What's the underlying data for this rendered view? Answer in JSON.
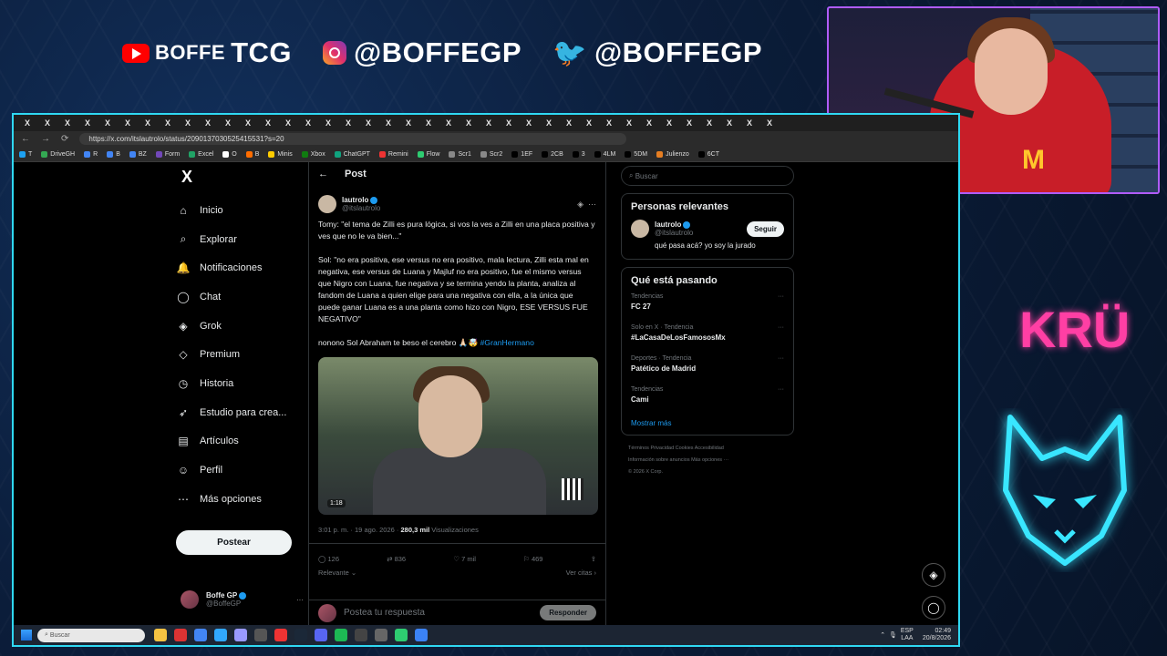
{
  "banner": {
    "yt_text": "BOFFE",
    "yt_bold": "TCG",
    "ig_handle": "@BOFFEGP",
    "tw_handle": "@BOFFEGP"
  },
  "overlay": {
    "kru_logo": "KRÜ"
  },
  "browser": {
    "tab_glyph": "X",
    "url": "https://x.com/itslautrolo/status/2090137030525415531?s=20",
    "bookmarks": [
      "T",
      "DriveGH",
      "R",
      "B",
      "BZ",
      "Form",
      "Excel",
      "O",
      "B",
      "Minis",
      "Xbox",
      "ChatGPT",
      "Remini",
      "Flow",
      "Scr1",
      "Scr2",
      "1EF",
      "2CB",
      "3",
      "4LM",
      "5DM",
      "Julienzo",
      "6CT"
    ]
  },
  "nav": {
    "logo": "X",
    "items": [
      {
        "icon": "⌂",
        "label": "Inicio"
      },
      {
        "icon": "⌕",
        "label": "Explorar"
      },
      {
        "icon": "🔔",
        "label": "Notificaciones"
      },
      {
        "icon": "◯",
        "label": "Chat"
      },
      {
        "icon": "◈",
        "label": "Grok"
      },
      {
        "icon": "◇",
        "label": "Premium"
      },
      {
        "icon": "◷",
        "label": "Historia"
      },
      {
        "icon": "➶",
        "label": "Estudio para crea..."
      },
      {
        "icon": "▤",
        "label": "Artículos"
      },
      {
        "icon": "☺",
        "label": "Perfil"
      },
      {
        "icon": "⋯",
        "label": "Más opciones"
      }
    ],
    "post_button": "Postear",
    "profile": {
      "name": "Boffe GP",
      "handle": "@BoffeGP"
    }
  },
  "post": {
    "header": "Post",
    "author": {
      "name": "lautrolo",
      "handle": "@itslautrolo"
    },
    "text_1": "Tomy: \"el tema de Zilli es pura lógica, si vos la ves a Zilli en una placa positiva y ves que no le va bien...\"",
    "text_2": "Sol: \"no era positiva, ese versus no era positivo, mala lectura, Zilli esta mal en negativa, ese versus de Luana y Majluf no era positivo, fue el mismo versus que Nigro con Luana, fue negativa y se termina yendo la planta, analiza al fandom de Luana a quien elige para una negativa con ella, a la única que puede ganar Luana es a una planta como hizo con Nigro, ESE VERSUS FUE NEGATIVO\"",
    "text_3": "nonono Sol Abraham te beso el cerebro 🙏🏻🤯",
    "hashtag": "#GranHermano",
    "video_time": "1:18",
    "timestamp": "3:01 p. m. · 19 ago. 2026 ·",
    "views_count": "280,3 mil",
    "views_label": "Visualizaciones",
    "stats": {
      "replies": "126",
      "reposts": "836",
      "likes": "7 mil",
      "bookmarks": "469"
    },
    "relevant": "Relevante",
    "quotes": "Ver citas",
    "reply_placeholder": "Postea tu respuesta",
    "reply_button": "Responder"
  },
  "sidebar": {
    "search_placeholder": "Buscar",
    "relevant_title": "Personas relevantes",
    "relevant_person": {
      "name": "lautrolo",
      "handle": "@itslautrolo",
      "bio": "qué pasa acá? yo soy la jurado",
      "follow": "Seguir"
    },
    "trends_title": "Qué está pasando",
    "trends": [
      {
        "context": "Tendencias",
        "topic": "FC 27"
      },
      {
        "context": "Solo en X · Tendencia",
        "topic": "#LaCasaDeLosFamososMx"
      },
      {
        "context": "Deportes · Tendencia",
        "topic": "Patético de Madrid"
      },
      {
        "context": "Tendencias",
        "topic": "Cami"
      }
    ],
    "show_more": "Mostrar más",
    "footer_1": "Términos    Privacidad    Cookies    Accesibilidad",
    "footer_2": "Información sobre anuncios    Más opciones ···",
    "footer_3": "© 2026 X Corp."
  },
  "taskbar": {
    "search": "Buscar",
    "lang_1": "ESP",
    "lang_2": "LAA",
    "time": "02:49",
    "date": "20/8/2026"
  }
}
